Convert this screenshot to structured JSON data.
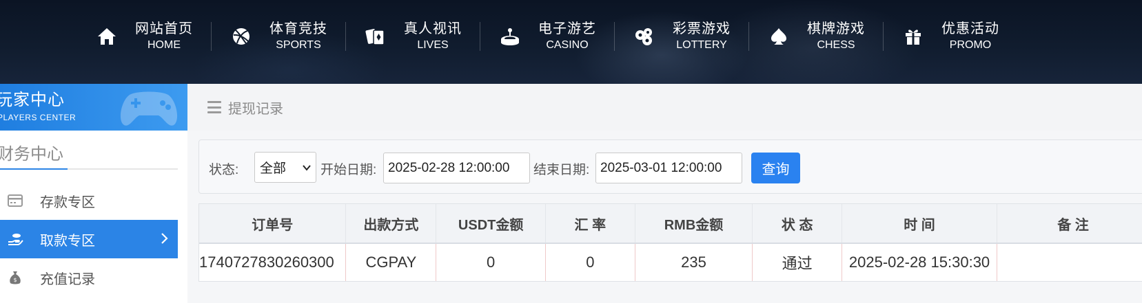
{
  "nav": [
    {
      "cn": "网站首页",
      "en": "HOME",
      "icon": "home-icon"
    },
    {
      "cn": "体育竞技",
      "en": "SPORTS",
      "icon": "basketball-icon"
    },
    {
      "cn": "真人视讯",
      "en": "LIVES",
      "icon": "cards-icon"
    },
    {
      "cn": "电子游艺",
      "en": "CASINO",
      "icon": "slot-machine-icon"
    },
    {
      "cn": "彩票游戏",
      "en": "LOTTERY",
      "icon": "lottery-balls-icon"
    },
    {
      "cn": "棋牌游戏",
      "en": "CHESS",
      "icon": "spade-icon"
    },
    {
      "cn": "优惠活动",
      "en": "PROMO",
      "icon": "gift-icon"
    }
  ],
  "sidebar": {
    "title_cn": "玩家中心",
    "title_en": "PLAYERS CENTER",
    "section": "财务中心",
    "items": [
      {
        "label": "存款专区",
        "icon": "card-icon",
        "active": false
      },
      {
        "label": "取款专区",
        "icon": "withdraw-hand-icon",
        "active": true
      },
      {
        "label": "充值记录",
        "icon": "money-bag-icon",
        "active": false
      }
    ]
  },
  "main": {
    "title": "提现记录"
  },
  "filter": {
    "status_label": "状态:",
    "status_value": "全部",
    "start_label": "开始日期:",
    "start_value": "2025-02-28 12:00:00",
    "end_label": "结束日期:",
    "end_value": "2025-03-01 12:00:00",
    "query_button": "查询"
  },
  "table": {
    "headers": [
      "订单号",
      "出款方式",
      "USDT金额",
      "汇 率",
      "RMB金额",
      "状 态",
      "时 间",
      "备 注"
    ],
    "rows": [
      [
        "1740727830260300",
        "CGPAY",
        "0",
        "0",
        "235",
        "通过",
        "2025-02-28 15:30:30",
        ""
      ]
    ]
  },
  "colors": {
    "accent": "#2b84e6",
    "button": "#2a82f0",
    "topbar": "#0b1424"
  }
}
